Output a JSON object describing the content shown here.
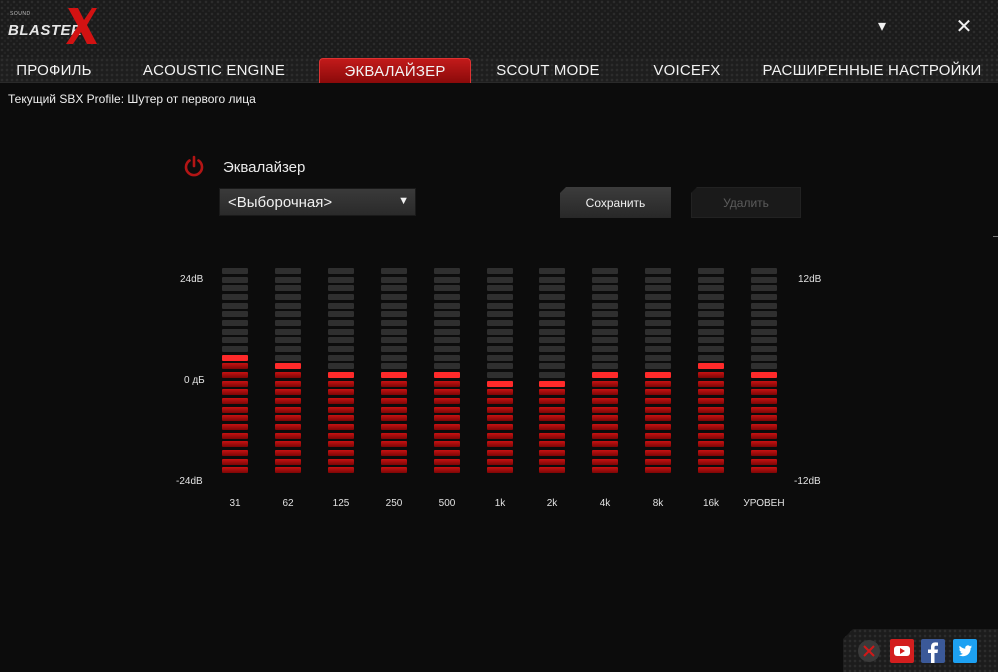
{
  "app": {
    "logo_small": "SOUND",
    "logo_text": "BLASTER",
    "min_glyph": "▾",
    "close_glyph": "✕"
  },
  "tabs": [
    {
      "label": "ПРОФИЛЬ",
      "active": false
    },
    {
      "label": "ACOUSTIC ENGINE",
      "active": false
    },
    {
      "label": "ЭКВАЛАЙЗЕР",
      "active": true
    },
    {
      "label": "SCOUT MODE",
      "active": false
    },
    {
      "label": "VOICEFX",
      "active": false
    },
    {
      "label": "РАСШИРЕННЫЕ НАСТРОЙКИ",
      "active": false
    }
  ],
  "profile_line": "Текущий SBX Profile: Шутер от первого лица",
  "equalizer": {
    "title": "Эквалайзер",
    "preset_value": "<Выборочная>",
    "save_label": "Сохранить",
    "delete_label": "Удалить",
    "left_scale": {
      "top": "24dB",
      "mid": "0 дБ",
      "bottom": "-24dB"
    },
    "right_scale": {
      "top": "12dB",
      "bottom": "-12dB"
    },
    "bands": [
      {
        "label": "31",
        "level": 0.58
      },
      {
        "label": "62",
        "level": 0.55
      },
      {
        "label": "125",
        "level": 0.5
      },
      {
        "label": "250",
        "level": 0.5
      },
      {
        "label": "500",
        "level": 0.5
      },
      {
        "label": "1k",
        "level": 0.45
      },
      {
        "label": "2k",
        "level": 0.45
      },
      {
        "label": "4k",
        "level": 0.5
      },
      {
        "label": "8k",
        "level": 0.5
      },
      {
        "label": "16k",
        "level": 0.54
      },
      {
        "label": "УРОВЕН",
        "level": 0.5
      }
    ]
  },
  "colors": {
    "accent": "#c21a1a",
    "segment_off": "#2f2f2f",
    "segment_on": "#b00d0d"
  },
  "social": [
    {
      "icon": "close-circle-icon"
    },
    {
      "icon": "youtube-icon"
    },
    {
      "icon": "facebook-icon"
    },
    {
      "icon": "twitter-icon"
    }
  ]
}
